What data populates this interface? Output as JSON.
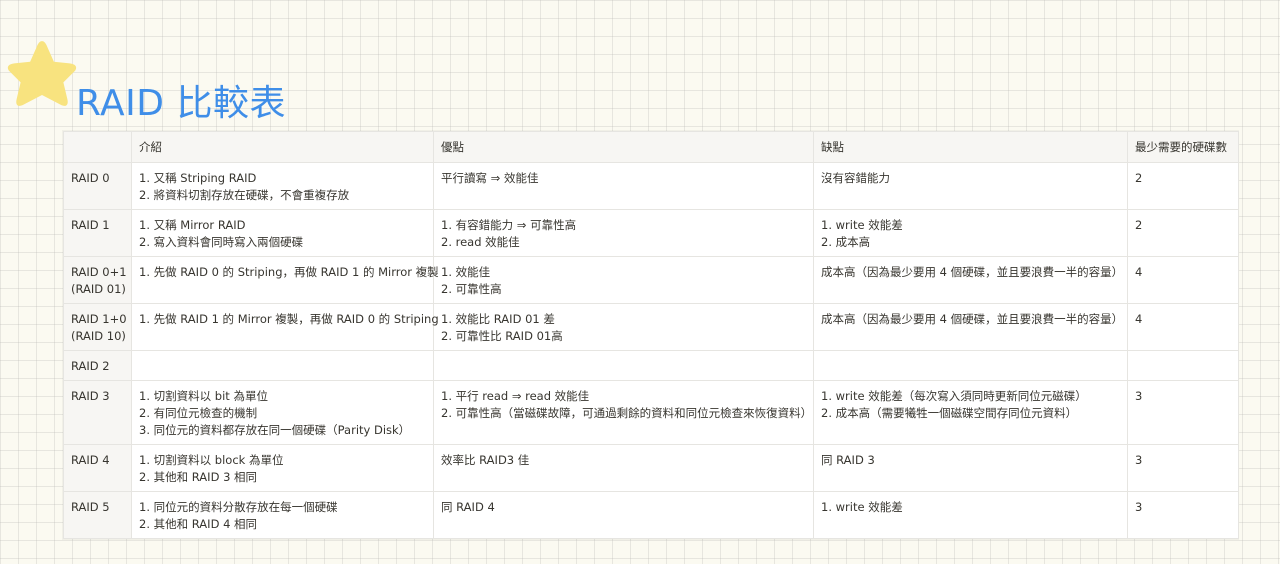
{
  "title": "RAID 比較表",
  "header": [
    "",
    "介紹",
    "優點",
    "缺點",
    "最少需要的硬碟數"
  ],
  "rows": [
    {
      "name": [
        "RAID 0"
      ],
      "intro": [
        "1. 又稱 Striping RAID",
        "2. 將資料切割存放在硬碟，不會重複存放"
      ],
      "pros": [
        "平行讀寫 ⇒ 效能佳"
      ],
      "cons": [
        "沒有容錯能力"
      ],
      "disks": "2"
    },
    {
      "name": [
        "RAID 1"
      ],
      "intro": [
        "1. 又稱 Mirror RAID",
        "2. 寫入資料會同時寫入兩個硬碟"
      ],
      "pros": [
        "1. 有容錯能力 ⇒ 可靠性高",
        "2. read 效能佳"
      ],
      "cons": [
        "1. write 效能差",
        "2. 成本高"
      ],
      "disks": "2"
    },
    {
      "name": [
        "RAID 0+1",
        "(RAID 01)"
      ],
      "intro": [
        "1. 先做 RAID 0 的 Striping，再做 RAID 1 的 Mirror 複製"
      ],
      "pros": [
        "1. 效能佳",
        "2. 可靠性高"
      ],
      "cons": [
        "成本高（因為最少要用 4 個硬碟，並且要浪費一半的容量）"
      ],
      "disks": "4"
    },
    {
      "name": [
        "RAID 1+0",
        "(RAID 10)"
      ],
      "intro": [
        "1. 先做 RAID 1 的 Mirror 複製，再做 RAID 0 的 Striping"
      ],
      "pros": [
        "1. 效能比 RAID 01 差",
        "2. 可靠性比 RAID 01高"
      ],
      "cons": [
        "成本高（因為最少要用 4 個硬碟，並且要浪費一半的容量）"
      ],
      "disks": "4"
    },
    {
      "name": [
        "RAID 2"
      ],
      "intro": [],
      "pros": [],
      "cons": [],
      "disks": ""
    },
    {
      "name": [
        "RAID 3"
      ],
      "intro": [
        "1. 切割資料以 bit 為單位",
        "2. 有同位元檢查的機制",
        "3. 同位元的資料都存放在同一個硬碟（Parity Disk）"
      ],
      "pros": [
        "1. 平行 read ⇒ read 效能佳",
        "2. 可靠性高（當磁碟故障，可通過剩餘的資料和同位元檢查來恢復資料）"
      ],
      "cons": [
        "1. write 效能差（每次寫入須同時更新同位元磁碟）",
        "2. 成本高（需要犧牲一個磁碟空間存同位元資料）"
      ],
      "disks": "3"
    },
    {
      "name": [
        "RAID 4"
      ],
      "intro": [
        "1. 切割資料以 block 為單位",
        "2. 其他和 RAID 3 相同"
      ],
      "pros": [
        "效率比 RAID3 佳"
      ],
      "cons": [
        "同 RAID 3"
      ],
      "disks": "3"
    },
    {
      "name": [
        "RAID 5"
      ],
      "intro": [
        "1. 同位元的資料分散存放在每一個硬碟",
        "2. 其他和 RAID 4 相同"
      ],
      "pros": [
        "同 RAID 4"
      ],
      "cons": [
        "1. write 效能差"
      ],
      "disks": "3"
    }
  ],
  "colors": {
    "title": "#3f8ee8",
    "star": "#f8e37f",
    "header_bg": "#f7f6f3",
    "grid": "#e6e5e1"
  },
  "icons": {
    "decoration": "star-icon"
  }
}
